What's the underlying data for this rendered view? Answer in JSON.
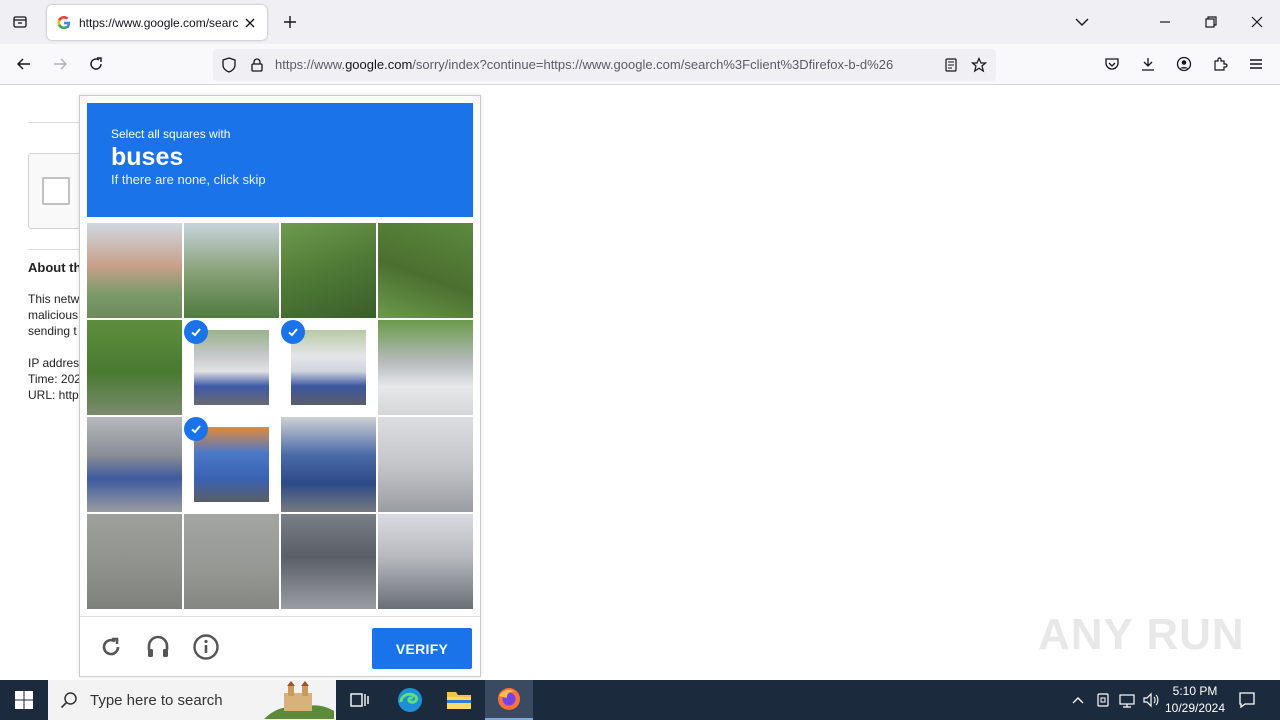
{
  "browser": {
    "tab_title": "https://www.google.com/search",
    "url_prefix": "https://www.",
    "url_domain": "google.com",
    "url_rest": "/sorry/index?continue=https://www.google.com/search%3Fclient%3Dfirefox-b-d%26"
  },
  "page": {
    "about_heading": "About this page",
    "line1": "This network",
    "line2": "malicious",
    "line3": "sending t",
    "ip_label": "IP address",
    "time_label": "Time: 202",
    "url_label": "URL: http"
  },
  "captcha": {
    "instruction": "Select all squares with",
    "target": "buses",
    "hint": "If there are none, click skip",
    "verify_label": "VERIFY",
    "selected_tiles": [
      5,
      6,
      9
    ]
  },
  "watermark": "ANY RUN",
  "taskbar": {
    "search_placeholder": "Type here to search",
    "time": "5:10 PM",
    "date": "10/29/2024"
  },
  "colors": {
    "accent": "#1a73e8",
    "taskbar": "#1c2a3d"
  }
}
